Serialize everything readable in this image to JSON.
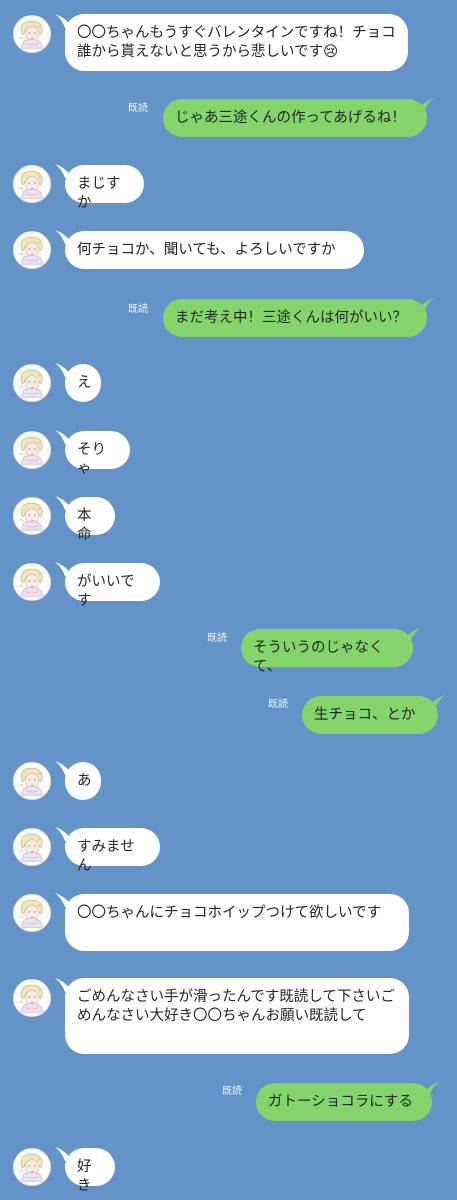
{
  "chat": {
    "read_label": "既読",
    "messages": [
      {
        "side": "left",
        "text": "〇〇ちゃんもうすぐバレンタインですね！チョコ誰から貰えないと思うから悲しいです😢"
      },
      {
        "side": "right",
        "text": "じゃあ三途くんの作ってあげるね！"
      },
      {
        "side": "left",
        "text": "まじすか"
      },
      {
        "side": "left",
        "text": "何チョコか、聞いても、よろしいですか"
      },
      {
        "side": "right",
        "text": "まだ考え中！三途くんは何がいい？"
      },
      {
        "side": "left",
        "text": "え"
      },
      {
        "side": "left",
        "text": "そりゃ"
      },
      {
        "side": "left",
        "text": "本命"
      },
      {
        "side": "left",
        "text": "がいいです"
      },
      {
        "side": "right",
        "text": "そういうのじゃなくて、"
      },
      {
        "side": "right",
        "text": "生チョコ、とか"
      },
      {
        "side": "left",
        "text": "あ"
      },
      {
        "side": "left",
        "text": "すみません"
      },
      {
        "side": "left",
        "text": "〇〇ちゃんにチョコホイップつけて欲しいです"
      },
      {
        "side": "left",
        "text": "ごめんなさい手が滑ったんです既読して下さいごめんなさい大好き〇〇ちゃんお願い既読して"
      },
      {
        "side": "right",
        "text": "ガトーショコラにする"
      },
      {
        "side": "left",
        "text": "好き"
      }
    ]
  }
}
